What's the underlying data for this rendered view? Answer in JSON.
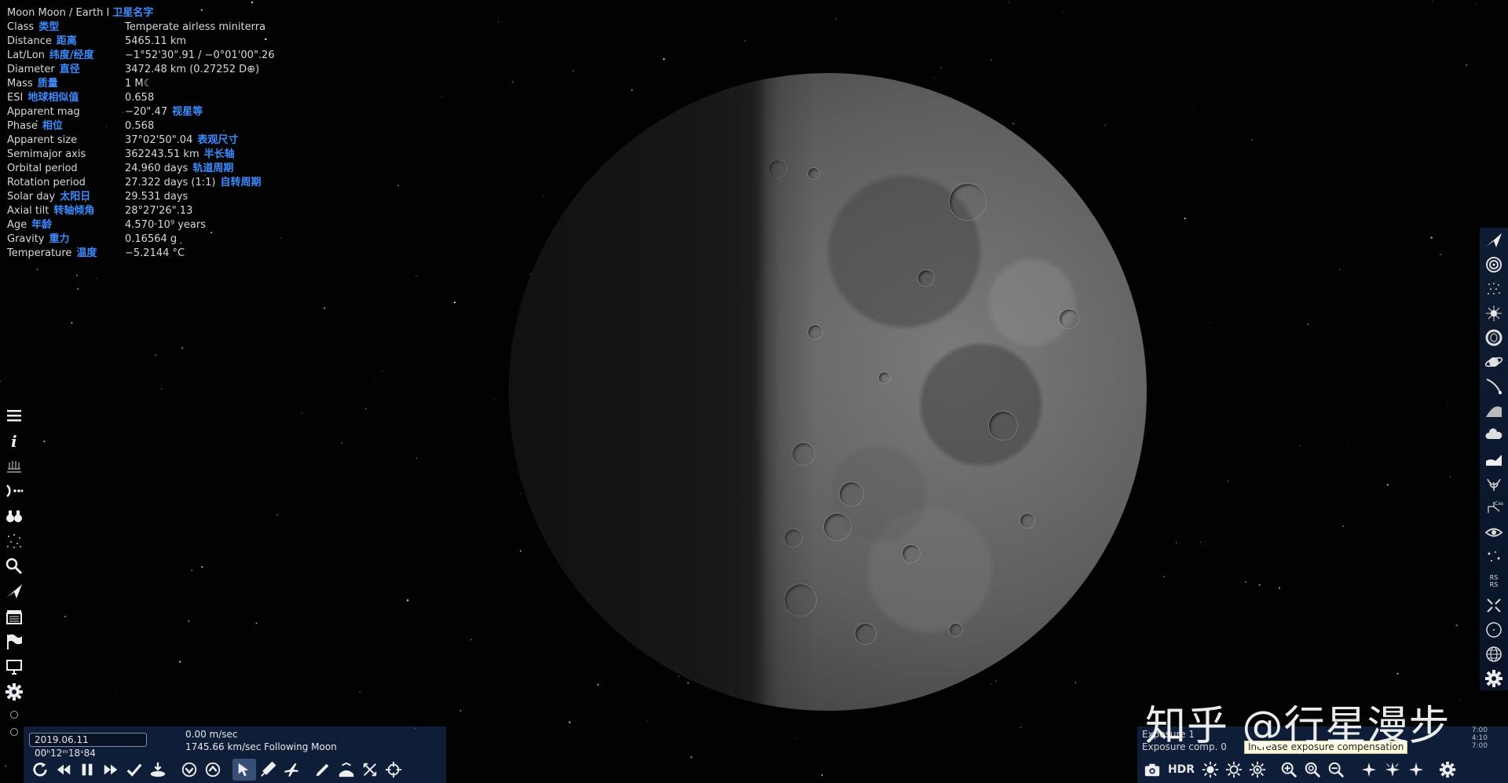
{
  "info": {
    "title": "Moon  Moon / Earth I",
    "title_cn": "卫星名字",
    "rows": [
      {
        "label": "Class",
        "cn": "类型",
        "value": "Temperate airless miniterra",
        "value_cn": ""
      },
      {
        "label": "Distance",
        "cn": "距离",
        "value": "5465.11 km",
        "value_cn": ""
      },
      {
        "label": "Lat/Lon",
        "cn": "纬度/经度",
        "value": "−1°52'30\".91 / −0°01'00\".26",
        "value_cn": ""
      },
      {
        "label": "Diameter",
        "cn": "直径",
        "value": "3472.48 km (0.27252 D⊕)",
        "value_cn": ""
      },
      {
        "label": "Mass",
        "cn": "质量",
        "value": "1 M☾",
        "value_cn": ""
      },
      {
        "label": "ESI",
        "cn": "地球相似值",
        "value": "0.658",
        "value_cn": ""
      },
      {
        "label": "Apparent mag",
        "cn": "",
        "value": "−20\".47",
        "value_cn": "视星等"
      },
      {
        "label": "Phase",
        "cn": "相位",
        "value": "0.568",
        "value_cn": ""
      },
      {
        "label": "Apparent size",
        "cn": "",
        "value": "37°02'50\".04",
        "value_cn": "表观尺寸"
      },
      {
        "label": "Semimajor axis",
        "cn": "",
        "value": "362243.51 km",
        "value_cn": "半长轴"
      },
      {
        "label": "Orbital period",
        "cn": "",
        "value": "24.960 days",
        "value_cn": "轨道周期"
      },
      {
        "label": "Rotation period",
        "cn": "",
        "value": "27.322 days (1:1)",
        "value_cn": "自转周期"
      },
      {
        "label": "Solar day",
        "cn": "太阳日",
        "value": "29.531 days",
        "value_cn": ""
      },
      {
        "label": "Axial tilt",
        "cn": "转轴倾角",
        "value": "28°27'26\".13",
        "value_cn": ""
      },
      {
        "label": "Age",
        "cn": "年龄",
        "value": "4.570·10⁹ years",
        "value_cn": ""
      },
      {
        "label": "Gravity",
        "cn": "重力",
        "value": "0.16564 g",
        "value_cn": ""
      },
      {
        "label": "Temperature",
        "cn": "温度",
        "value": "−5.2144 °C",
        "value_cn": ""
      }
    ]
  },
  "left_toolbar": [
    {
      "name": "menu-icon",
      "glyph": "menu"
    },
    {
      "name": "info-icon",
      "glyph": "info"
    },
    {
      "name": "telescope-icon",
      "glyph": "tele"
    },
    {
      "name": "orbit-icon",
      "glyph": "orbit"
    },
    {
      "name": "binoculars-icon",
      "glyph": "bino"
    },
    {
      "name": "stars-icon",
      "glyph": "stars"
    },
    {
      "name": "search-icon",
      "glyph": "search"
    },
    {
      "name": "spaceship-icon",
      "glyph": "ship"
    },
    {
      "name": "clapperboard-icon",
      "glyph": "clap"
    },
    {
      "name": "flag-icon",
      "glyph": "flag"
    },
    {
      "name": "monitor-icon",
      "glyph": "monitor"
    },
    {
      "name": "gear-icon",
      "glyph": "gear"
    }
  ],
  "right_toolbar": [
    {
      "name": "spaceship-icon"
    },
    {
      "name": "galaxy-icon"
    },
    {
      "name": "star-cluster-icon"
    },
    {
      "name": "nebula-icon"
    },
    {
      "name": "ring-icon"
    },
    {
      "name": "planet-rings-icon"
    },
    {
      "name": "comet-icon"
    },
    {
      "name": "atmosphere-icon"
    },
    {
      "name": "clouds-icon"
    },
    {
      "name": "water-icon"
    },
    {
      "name": "life-icon"
    },
    {
      "name": "constellations-icon"
    },
    {
      "name": "eye-icon"
    },
    {
      "name": "point-stars-icon"
    },
    {
      "name": "rs-labels-icon"
    },
    {
      "name": "expand-icon"
    },
    {
      "name": "target-circle-icon"
    },
    {
      "name": "globe-grid-icon"
    },
    {
      "name": "gear-icon"
    }
  ],
  "right_rs_labels": [
    "RS",
    "RS"
  ],
  "bottom_left": {
    "date": "2019.06.11 00ʰ12ᵐ18ˢ84",
    "speed1": "0.00 m/sec",
    "speed2": "1745.66 km/sec   Following Moon"
  },
  "bottom_right": {
    "exposure_line1": "Exposure 1",
    "exposure_line2": "Exposure comp. 0",
    "tooltip": "Increase exposure compensation",
    "mini_time": [
      "7:00",
      "4:10",
      "7:00"
    ],
    "hdr": "HDR"
  },
  "watermark": "知乎 @行星漫步",
  "colors": {
    "accent_cn": "#3b8cff",
    "panel_bg": "#14284b",
    "tooltip_bg": "#fffde1"
  }
}
